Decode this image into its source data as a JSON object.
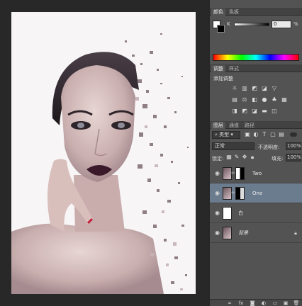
{
  "colors": {
    "canvas_bg": "#282828",
    "panel_bg": "#535353",
    "selected_layer": "#6b7c8f",
    "doc_bg": "#f7f5f6"
  },
  "color_panel": {
    "tabs": [
      "颜色",
      "色板"
    ],
    "slider_label": "K",
    "value": "0",
    "unit": "%"
  },
  "adjust_panel": {
    "tabs": [
      "调整",
      "样式"
    ],
    "title": "添加调整",
    "row1_icons": [
      "brightness-icon",
      "levels-icon",
      "curves-icon",
      "exposure-icon",
      "vibrance-icon"
    ],
    "row2_icons": [
      "hue-saturation-icon",
      "color-balance-icon",
      "black-white-icon",
      "photo-filter-icon",
      "channel-mixer-icon",
      "color-lookup-icon"
    ],
    "row3_icons": [
      "invert-icon",
      "posterize-icon",
      "threshold-icon",
      "gradient-map-icon",
      "selective-color-icon"
    ]
  },
  "layers_panel": {
    "tabs": [
      "图层",
      "通道",
      "路径"
    ],
    "filter_label": "类型",
    "blend_mode": "正常",
    "opacity_label": "不透明度:",
    "opacity_value": "100%",
    "lock_label": "锁定:",
    "fill_label": "填充:",
    "fill_value": "100%",
    "layers": [
      {
        "name": "Two",
        "selected": false
      },
      {
        "name": "One",
        "selected": true
      },
      {
        "name": "白",
        "selected": false
      },
      {
        "name": "背景",
        "selected": false
      }
    ]
  },
  "bottom_icons": [
    "link-icon",
    "fx-icon",
    "mask-icon",
    "adjustment-icon",
    "folder-icon",
    "new-layer-icon",
    "trash-icon"
  ]
}
